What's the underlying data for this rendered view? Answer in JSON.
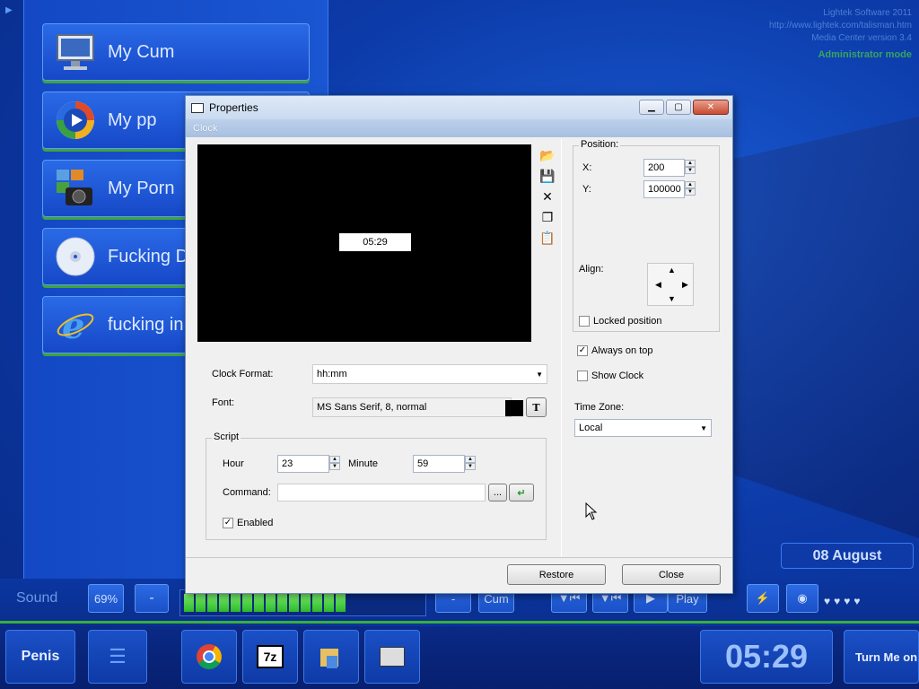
{
  "desktop": {
    "brand": {
      "line1": "Lightek Software 2011",
      "line2": "http://www.lightek.com/talisman.htm",
      "line3": "Media Center version 3.4",
      "mode": "Administrator mode"
    },
    "menu_items": [
      {
        "label": "My Cum",
        "icon": "monitor-icon"
      },
      {
        "label": "My pp",
        "icon": "media-player-icon"
      },
      {
        "label": "My Porn",
        "icon": "camera-photos-icon"
      },
      {
        "label": "Fucking D",
        "icon": "cd-icon"
      },
      {
        "label": "fucking in",
        "icon": "internet-explorer-icon"
      }
    ],
    "date": "08 August"
  },
  "sound_bar": {
    "label": "Sound",
    "volume_percent": "69%",
    "volume_level": 0.69,
    "minus": "-",
    "btn_minus2": "-",
    "btn_cum": "Cum",
    "btn_play": "Play"
  },
  "taskbar": {
    "start_label": "Penis",
    "clock": "05:29",
    "turn_me_on": "Turn Me on"
  },
  "dialog": {
    "title": "Properties",
    "section": "Clock",
    "preview_clock": "05:29",
    "position_group": "Position:",
    "x_label": "X:",
    "x_value": "200",
    "y_label": "Y:",
    "y_value": "100000",
    "align_label": "Align:",
    "locked_position": "Locked position",
    "always_on_top": "Always on top",
    "show_clock": "Show Clock",
    "time_zone_label": "Time Zone:",
    "time_zone_value": "Local",
    "clock_format_label": "Clock Format:",
    "clock_format_value": "hh:mm",
    "font_label": "Font:",
    "font_value": "MS Sans Serif, 8, normal",
    "font_button": "T",
    "script_group": "Script",
    "hour_label": "Hour",
    "hour_value": "23",
    "minute_label": "Minute",
    "minute_value": "59",
    "command_label": "Command:",
    "command_value": "",
    "browse_button": "...",
    "enabled_label": "Enabled",
    "restore_button": "Restore",
    "close_button": "Close"
  },
  "colors": {
    "accent": "#1a56d2",
    "green_bar": "#38b03a"
  }
}
